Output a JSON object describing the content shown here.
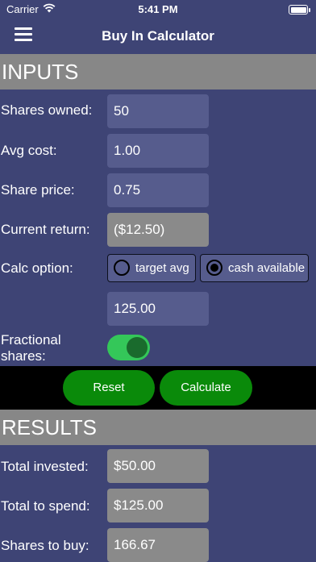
{
  "status_bar": {
    "carrier": "Carrier",
    "time": "5:41 PM",
    "battery_level": 1.0
  },
  "nav": {
    "title": "Buy In Calculator",
    "menu_icon": "hamburger-menu-icon"
  },
  "inputs": {
    "header": "INPUTS",
    "shares_owned": {
      "label": "Shares owned:",
      "value": "50"
    },
    "avg_cost": {
      "label": "Avg cost:",
      "value": "1.00"
    },
    "share_price": {
      "label": "Share price:",
      "value": "0.75"
    },
    "current_return": {
      "label": "Current return:",
      "value": "($12.50)"
    },
    "calc_option": {
      "label": "Calc option:",
      "options": [
        {
          "label": "target avg",
          "selected": false
        },
        {
          "label": "cash available",
          "selected": true
        }
      ],
      "value": "125.00"
    },
    "fractional": {
      "label_line1": "Fractional",
      "label_line2": "shares:",
      "on": true
    }
  },
  "buttons": {
    "reset": "Reset",
    "calculate": "Calculate"
  },
  "results": {
    "header": "RESULTS",
    "total_invested": {
      "label": "Total invested:",
      "value": "$50.00"
    },
    "total_to_spend": {
      "label": "Total to spend:",
      "value": "$125.00"
    },
    "shares_to_buy": {
      "label": "Shares to buy:",
      "value": "166.67"
    }
  },
  "colors": {
    "background": "#3e4475",
    "section_header": "#878787",
    "input_field": "#565c8d",
    "readonly_field": "#8a8a8a",
    "button_green": "#0a8a0a",
    "toggle_on": "#34c759"
  }
}
